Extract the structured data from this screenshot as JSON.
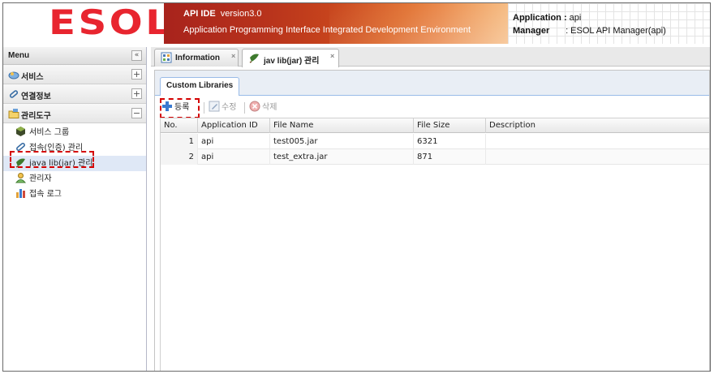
{
  "header": {
    "logo_text": "ESOL",
    "app_name": "API IDE",
    "version": "version3.0",
    "subtitle": "Application Programming Interface Integrated Development Environment",
    "application_label": "Application :",
    "application_value": "api",
    "manager_label": "Manager",
    "manager_value": ": ESOL API Manager(api)"
  },
  "sidebar": {
    "title": "Menu",
    "collapse_glyph": "«",
    "sections": [
      {
        "label": "서비스",
        "state": "+"
      },
      {
        "label": "연결정보",
        "state": "+"
      },
      {
        "label": "관리도구",
        "state": "−"
      }
    ],
    "items": [
      {
        "label": "서비스 그룹"
      },
      {
        "label": "접속(인증) 관리"
      },
      {
        "label": "java lib(jar) 관리"
      },
      {
        "label": "관리자"
      },
      {
        "label": "접속 로그"
      }
    ]
  },
  "tabs": [
    {
      "label": "Information",
      "close": "×"
    },
    {
      "label": "jav lib(jar) 관리",
      "close": "×"
    }
  ],
  "panel": {
    "subtab": "Custom Libraries",
    "toolbar": {
      "add": "등록",
      "edit": "수정",
      "delete": "삭제"
    },
    "columns": [
      "No.",
      "Application ID",
      "File Name",
      "File Size",
      "Description"
    ],
    "rows": [
      {
        "no": "1",
        "app_id": "api",
        "file_name": "test005.jar",
        "file_size": "6321",
        "description": ""
      },
      {
        "no": "2",
        "app_id": "api",
        "file_name": "test_extra.jar",
        "file_size": "871",
        "description": ""
      }
    ]
  },
  "colors": {
    "accent_red": "#d40000",
    "brand_red": "#e8252f",
    "selection": "#dfe8f6"
  }
}
